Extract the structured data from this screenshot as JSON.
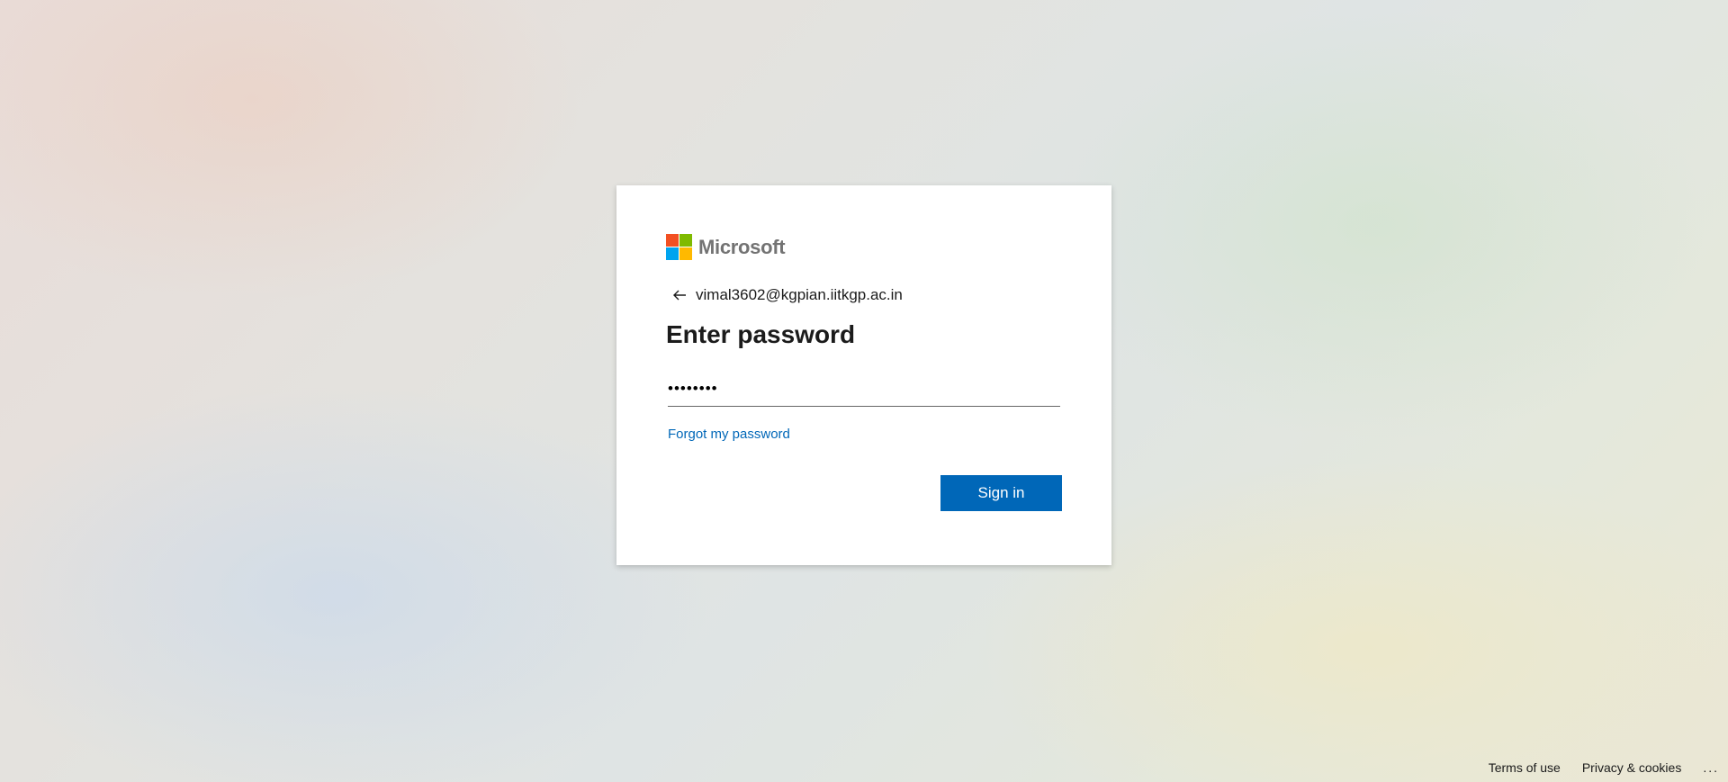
{
  "brand": {
    "name": "Microsoft",
    "logo_colors": [
      "#f25022",
      "#7fba00",
      "#00a4ef",
      "#ffb900"
    ]
  },
  "signin": {
    "account_email": "vimal3602@kgpian.iitkgp.ac.in",
    "title": "Enter password",
    "password_value": "••••••••",
    "forgot_link": "Forgot my password",
    "submit_label": "Sign in",
    "accent_color": "#0067b8"
  },
  "footer": {
    "terms": "Terms of use",
    "privacy": "Privacy & cookies",
    "more": "..."
  }
}
